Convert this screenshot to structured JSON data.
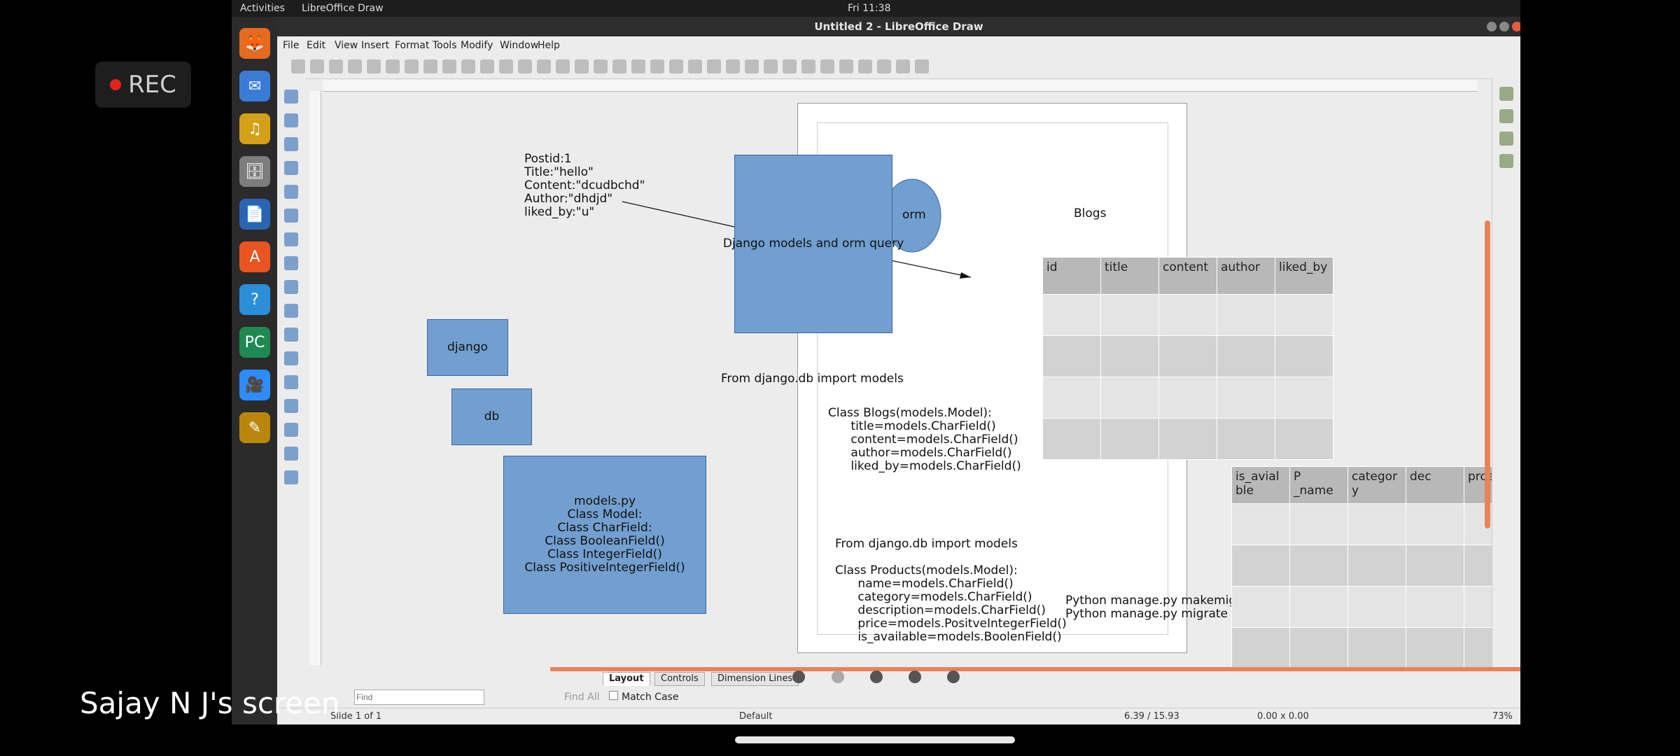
{
  "recording": {
    "label": "REC"
  },
  "gnome": {
    "activities": "Activities",
    "app_name": "LibreOffice Draw",
    "clock": "Fri 11:38"
  },
  "window": {
    "title": "Untitled 2 - LibreOffice Draw"
  },
  "menubar": [
    "File",
    "Edit",
    "View",
    "Insert",
    "Format",
    "Tools",
    "Modify",
    "Window",
    "Help"
  ],
  "dock_icons": [
    "firefox-icon",
    "thunderbird-icon",
    "rhythmbox-icon",
    "files-icon",
    "writer-icon",
    "software-icon",
    "help-icon",
    "pycharm-icon",
    "zoom-icon",
    "draw-icon"
  ],
  "dock_glyphs": [
    "🦊",
    "✉",
    "♫",
    "🗄",
    "📄",
    "A",
    "?",
    "PC",
    "🎥",
    "✎"
  ],
  "canvas": {
    "post_text": "Postid:1\nTitle:\"hello\"\nContent:\"dcudbchd\"\nAuthor:\"dhdjd\"\nliked_by:\"u\"",
    "main_box": "Django models and orm query",
    "orm": "orm",
    "blogs": "Blogs",
    "django": "django",
    "db": "db",
    "models_box": "models.py\nClass Model:\nClass CharField:\nClass BooleanField()\nClass IntegerField()\nClass PositiveIntegerField()",
    "import1": "From django.db import models",
    "class_blogs": "Class Blogs(models.Model):\n      title=models.CharField()\n      content=models.CharField()\n      author=models.CharField()\n      liked_by=models.CharField()",
    "import2": "From django.db import models",
    "class_products": "Class Products(models.Model):\n      name=models.CharField()\n      category=models.CharField()\n      description=models.CharField()\n      price=models.PositveIntegerField()\n      is_available=models.BoolenField()",
    "manage": "Python manage.py makemigations\nPython manage.py migrate"
  },
  "blogs_table": {
    "headers": [
      "id",
      "title",
      "content",
      "author",
      "liked_by"
    ]
  },
  "products_table": {
    "headers": [
      "is_avial\nble",
      "P\n_name",
      "categor\ny",
      "dec",
      "prce"
    ]
  },
  "tabs": [
    "Layout",
    "Controls",
    "Dimension Lines"
  ],
  "findbar": {
    "placeholder": "Find",
    "find_all": "Find All",
    "match_case": "Match Case"
  },
  "statusbar": {
    "slide": "Slide 1 of 1",
    "layout": "Default",
    "position": "6.39 / 15.93",
    "size": "0.00 x 0.00",
    "zoom": "73%"
  },
  "share_label": "Sajay N J's screen",
  "colors": {
    "shape_fill": "#729fcf",
    "accent": "#e8825a"
  }
}
